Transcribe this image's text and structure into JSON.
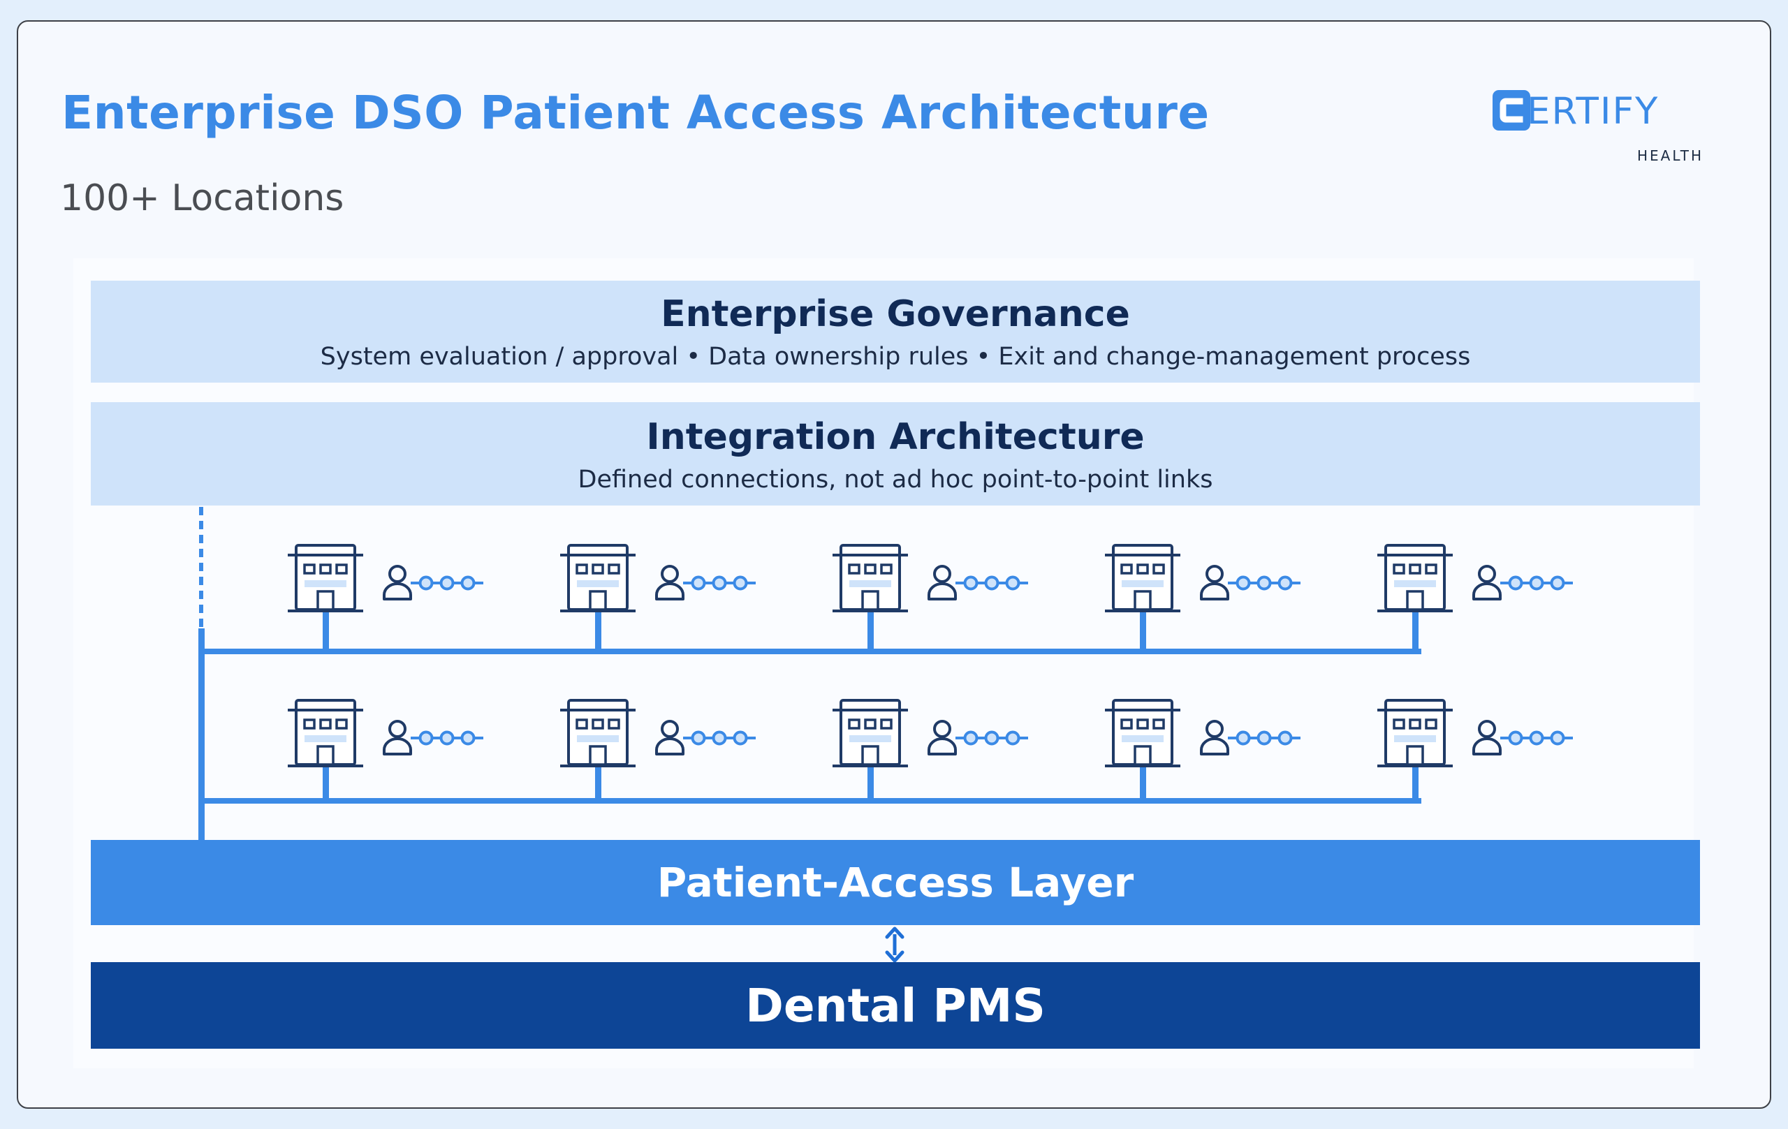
{
  "header": {
    "title": "Enterprise DSO Patient Access Architecture",
    "subtitle": "100+ Locations"
  },
  "logo": {
    "wordmark": "ERTIFY",
    "mark_letter": "C",
    "tagline": "HEALTH",
    "brand_color": "#3b8ae6"
  },
  "diagram": {
    "governance": {
      "title": "Enterprise Governance",
      "description": "System evaluation / approval • Data ownership rules • Exit and change-management process"
    },
    "integration": {
      "title": "Integration Architecture",
      "description": "Defined connections, not ad hoc point-to-point links"
    },
    "locations": {
      "rows": 2,
      "per_row": 5,
      "node_icons": [
        "building-icon",
        "person-icon",
        "connector-dots-icon"
      ]
    },
    "connector": "up-down-arrow-icon",
    "patient_access": {
      "title": "Patient-Access Layer"
    },
    "pms": {
      "title": "Dental PMS"
    },
    "colors": {
      "band_light": "#cfe3fa",
      "band_mid": "#3b8ae6",
      "band_dark": "#0d4596",
      "line": "#3b8ae6",
      "icon_outline": "#1f3a66"
    }
  }
}
